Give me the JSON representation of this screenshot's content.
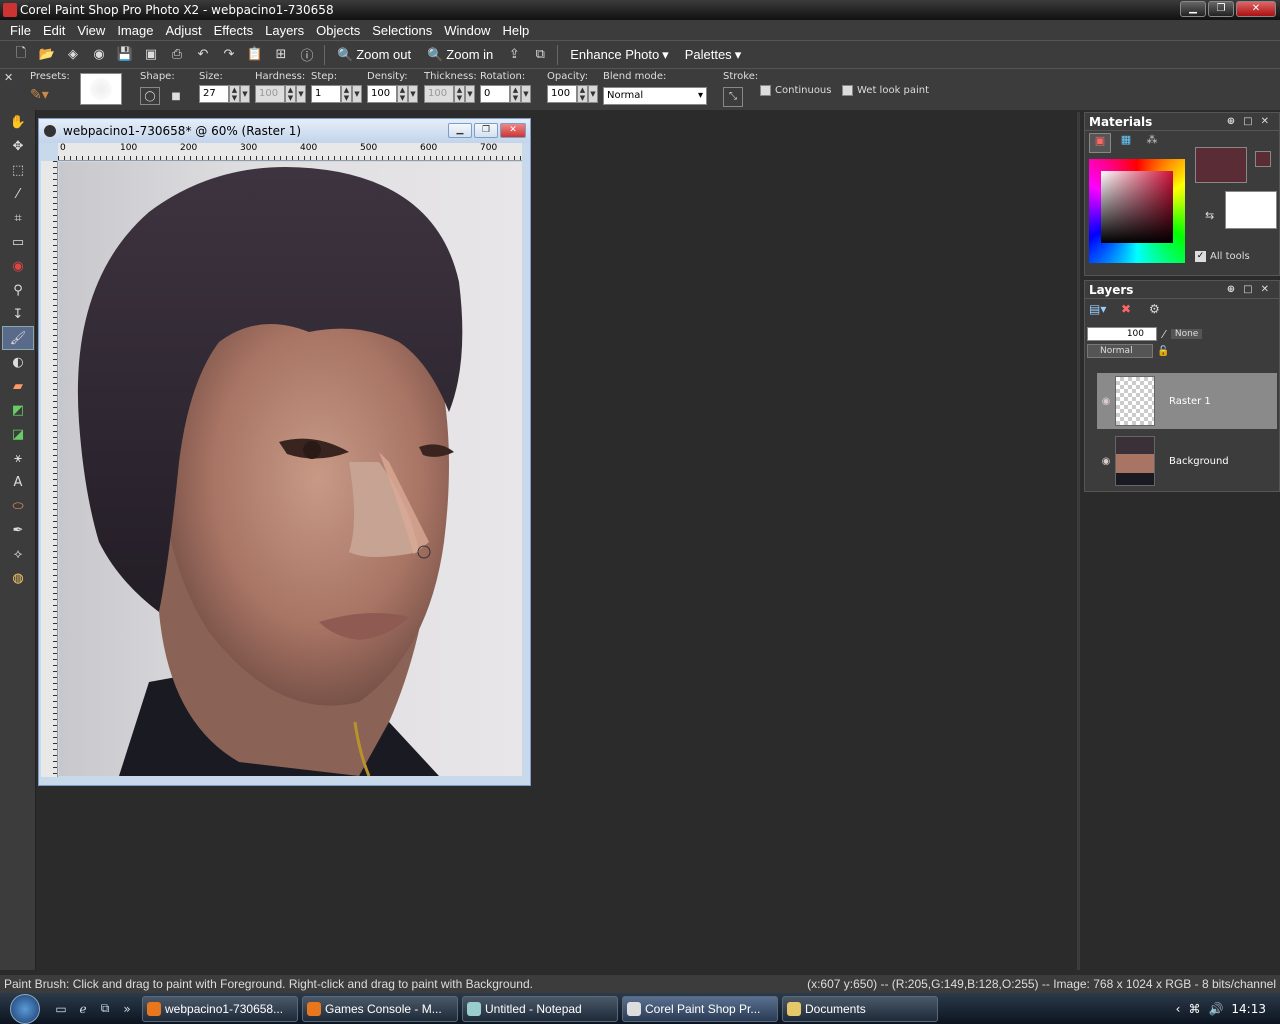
{
  "window": {
    "title": "Corel Paint Shop Pro Photo X2 - webpacino1-730658"
  },
  "menu": [
    "File",
    "Edit",
    "View",
    "Image",
    "Adjust",
    "Effects",
    "Layers",
    "Objects",
    "Selections",
    "Window",
    "Help"
  ],
  "toolbar": {
    "zoom_out": "Zoom out",
    "zoom_in": "Zoom in",
    "enhance_photo": "Enhance Photo",
    "palettes": "Palettes"
  },
  "options": {
    "presets_label": "Presets:",
    "shape_label": "Shape:",
    "size_label": "Size:",
    "size_value": "27",
    "hardness_label": "Hardness:",
    "hardness_value": "100",
    "step_label": "Step:",
    "step_value": "1",
    "density_label": "Density:",
    "density_value": "100",
    "thickness_label": "Thickness:",
    "thickness_value": "100",
    "rotation_label": "Rotation:",
    "rotation_value": "0",
    "opacity_label": "Opacity:",
    "opacity_value": "100",
    "blend_label": "Blend mode:",
    "blend_value": "Normal",
    "stroke_label": "Stroke:",
    "continuous_label": "Continuous",
    "wet_label": "Wet look paint"
  },
  "document": {
    "title": "webpacino1-730658* @  60% (Raster 1)",
    "ruler_ticks": [
      "0",
      "100",
      "200",
      "300",
      "400",
      "500",
      "600",
      "700"
    ]
  },
  "materials": {
    "title": "Materials",
    "all_tools_label": "All tools",
    "foreground_color": "#5a2c36",
    "background_color": "#ffffff"
  },
  "layers": {
    "title": "Layers",
    "opacity_value": "100",
    "none_label": "None",
    "blend_value": "Normal",
    "items": [
      {
        "name": "Raster 1"
      },
      {
        "name": "Background"
      }
    ]
  },
  "status": {
    "hint": "Paint Brush: Click and drag to paint with Foreground. Right-click and drag to paint with Background.",
    "info": "(x:607 y:650) -- (R:205,G:149,B:128,O:255) -- Image:  768 x 1024 x RGB - 8 bits/channel"
  },
  "taskbar": {
    "tasks": [
      "webpacino1-730658...",
      "Games Console - M...",
      "Untitled - Notepad",
      "Corel Paint Shop Pr...",
      "Documents"
    ],
    "clock": "14:13"
  }
}
